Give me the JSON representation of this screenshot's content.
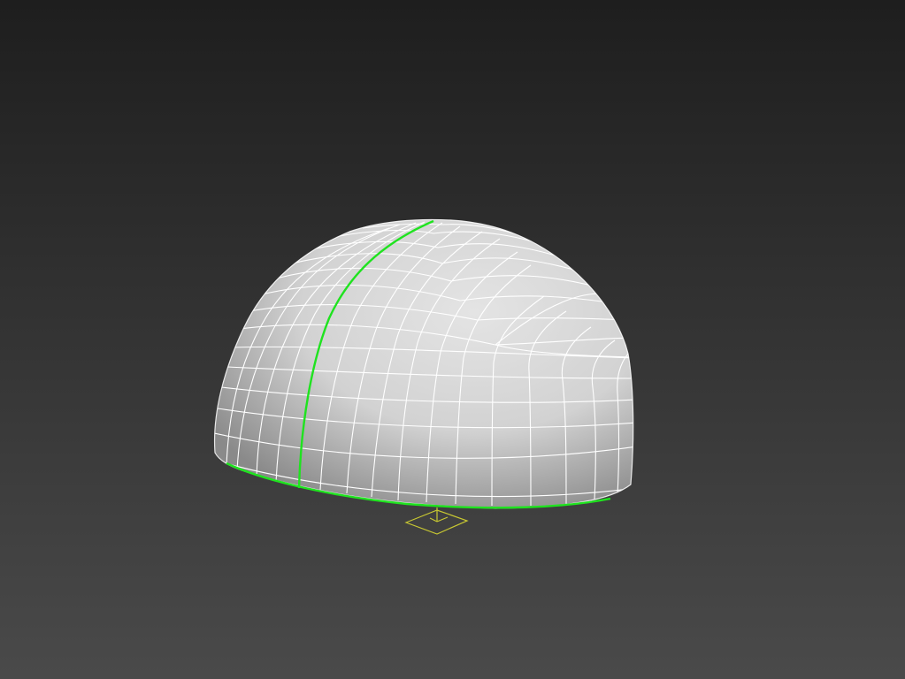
{
  "viewport": {
    "view": "perspective",
    "shading": "shaded-with-edged-faces",
    "background": {
      "top_color": "#1e1e1e",
      "bottom_color": "#4a4a4a"
    }
  },
  "object": {
    "type": "hemisphere-mesh",
    "surface_color": "#d2d2d2",
    "shadow_color": "#8a8a8a",
    "wire_color": "#ffffff",
    "selected_edge_color": "#1fe31f"
  },
  "pivot_gizmo": {
    "color": "#c8c832"
  }
}
